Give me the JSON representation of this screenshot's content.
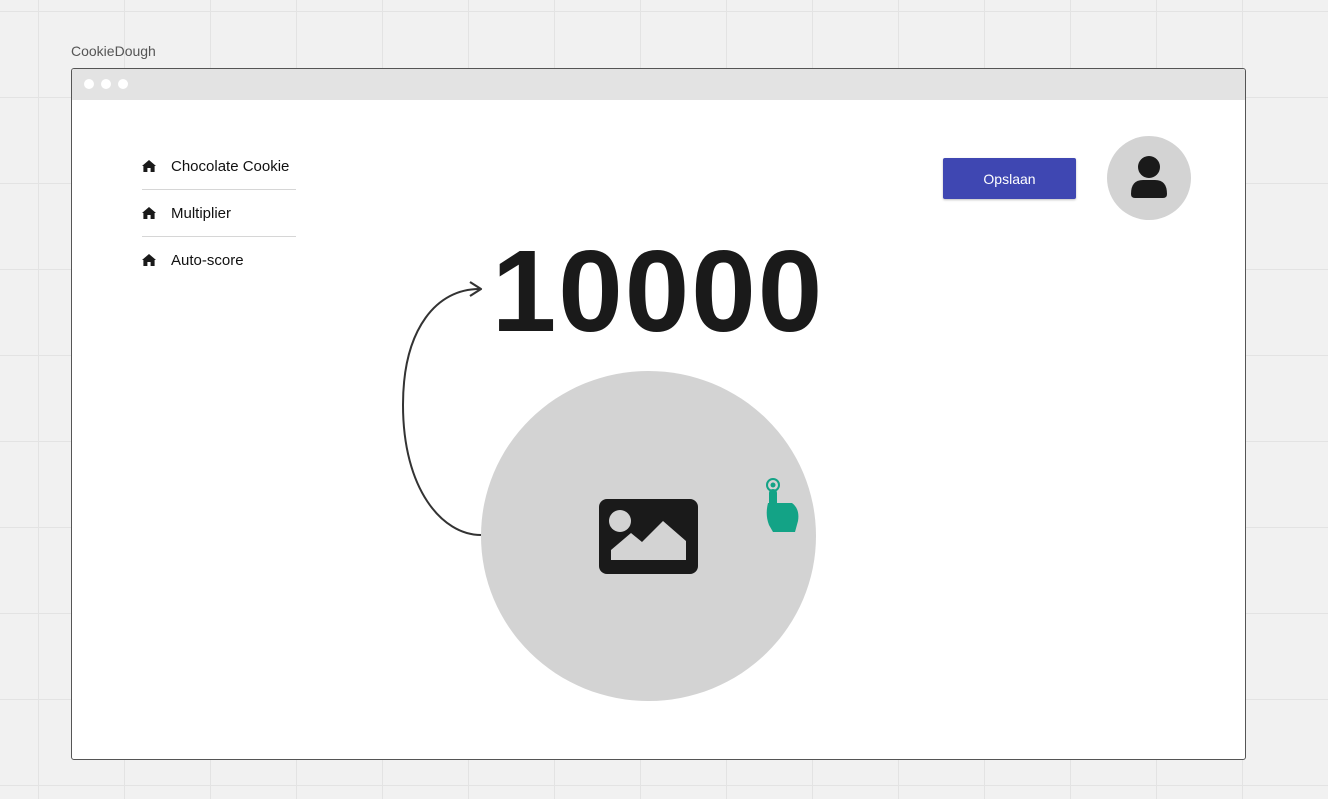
{
  "board": {
    "label": "CookieDough"
  },
  "nav": {
    "items": [
      {
        "label": "Chocolate Cookie",
        "icon": "home-icon"
      },
      {
        "label": "Multiplier",
        "icon": "home-icon"
      },
      {
        "label": "Auto-score",
        "icon": "home-icon"
      }
    ]
  },
  "header": {
    "save_label": "Opslaan"
  },
  "avatar": {
    "icon": "user-icon"
  },
  "score": {
    "value": "10000"
  },
  "cookie": {
    "icon": "image-placeholder-icon",
    "pointer_icon": "tap-hand-icon"
  },
  "colors": {
    "button": "#3f47b2",
    "pointer": "#13a386",
    "placeholder": "#d3d3d3",
    "text": "#1a1a1a"
  }
}
